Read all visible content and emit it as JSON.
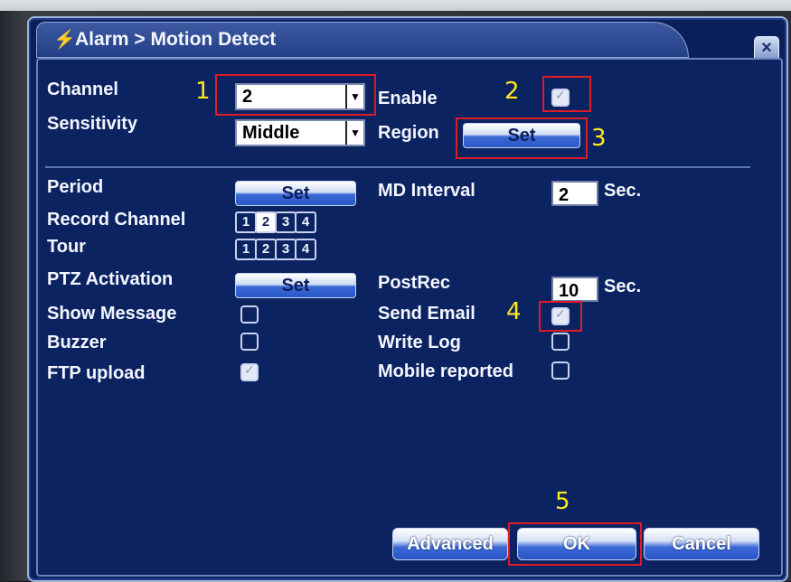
{
  "window": {
    "title": "Alarm > Motion Detect",
    "title_icon": "alarm-icon",
    "close_icon": "close-icon"
  },
  "top": {
    "channel_label": "Channel",
    "channel_value": "2",
    "enable_label": "Enable",
    "enable_checked": true,
    "sensitivity_label": "Sensitivity",
    "sensitivity_value": "Middle",
    "region_label": "Region",
    "region_button": "Set"
  },
  "settings": {
    "period_label": "Period",
    "period_button": "Set",
    "md_interval_label": "MD Interval",
    "md_interval_value": "2",
    "md_interval_unit": "Sec.",
    "record_channel_label": "Record Channel",
    "record_channels": [
      {
        "label": "1",
        "checked": false
      },
      {
        "label": "2",
        "checked": true
      },
      {
        "label": "3",
        "checked": false
      },
      {
        "label": "4",
        "checked": false
      }
    ],
    "tour_label": "Tour",
    "tour_channels": [
      {
        "label": "1",
        "checked": false
      },
      {
        "label": "2",
        "checked": false
      },
      {
        "label": "3",
        "checked": false
      },
      {
        "label": "4",
        "checked": false
      }
    ],
    "ptz_label": "PTZ Activation",
    "ptz_button": "Set",
    "postrec_label": "PostRec",
    "postrec_value": "10",
    "postrec_unit": "Sec.",
    "show_message_label": "Show Message",
    "show_message_checked": false,
    "send_email_label": "Send Email",
    "send_email_checked": true,
    "buzzer_label": "Buzzer",
    "buzzer_checked": false,
    "write_log_label": "Write Log",
    "write_log_checked": false,
    "ftp_label": "FTP upload",
    "ftp_checked": true,
    "mobile_label": "Mobile reported",
    "mobile_checked": false
  },
  "footer": {
    "advanced_button": "Advanced",
    "ok_button": "OK",
    "cancel_button": "Cancel"
  },
  "annotations": [
    "1",
    "2",
    "3",
    "4",
    "5"
  ],
  "colors": {
    "window_bg": "#0c2362",
    "annotation_box": "#e01b24",
    "annotation_number": "#ffe81a"
  }
}
